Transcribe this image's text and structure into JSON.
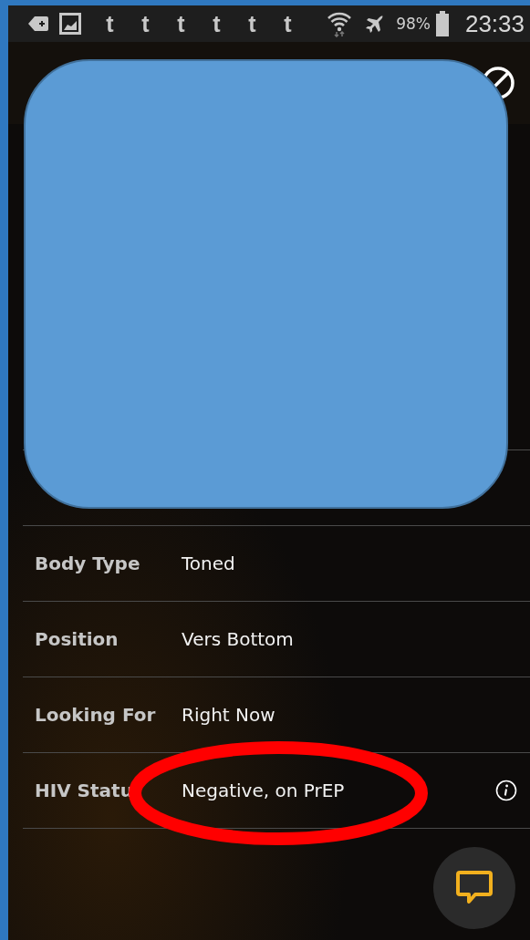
{
  "status_bar": {
    "notifications": [
      "t",
      "t",
      "t",
      "t",
      "t",
      "t"
    ],
    "battery": "98%",
    "time": "23:33"
  },
  "profile": {
    "rows": [
      {
        "label": "Body Type",
        "value": "Toned",
        "info": false
      },
      {
        "label": "Position",
        "value": "Vers Bottom",
        "info": false
      },
      {
        "label": "Looking For",
        "value": "Right Now",
        "info": false
      },
      {
        "label": "HIV Statu",
        "value": "Negative, on PrEP",
        "info": true
      }
    ]
  }
}
